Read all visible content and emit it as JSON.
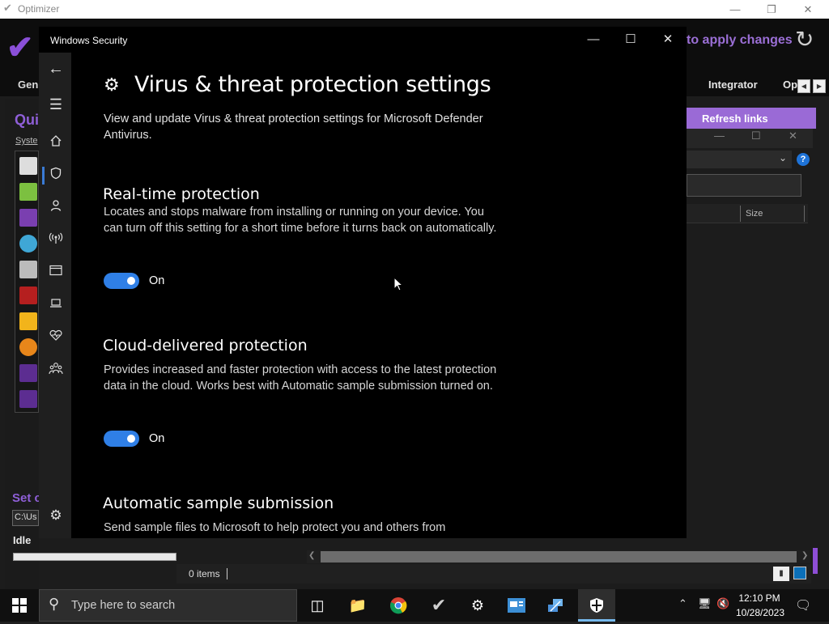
{
  "optimizer": {
    "window_title": "Optimizer",
    "apply_text": "to apply changes",
    "tab_gen": "Gen",
    "tab_integrator": "Integrator",
    "tab_op": "Op",
    "section_qui": "Qui",
    "section_syste": "Syste",
    "section_set": "Set c",
    "path_value": "C:\\Us",
    "status_idle": "Idle",
    "refresh_links": "Refresh links",
    "column_size": "Size",
    "items_count": "0 items",
    "accent_color": "#8e4ed6"
  },
  "security": {
    "window_title": "Windows Security",
    "heading": "Virus & threat protection settings",
    "description": "View and update Virus & threat protection settings for Microsoft Defender Antivirus.",
    "sections": [
      {
        "title": "Real-time protection",
        "description": "Locates and stops malware from installing or running on your device. You can turn off this setting for a short time before it turns back on automatically.",
        "toggle_state": "On"
      },
      {
        "title": "Cloud-delivered protection",
        "description": "Provides increased and faster protection with access to the latest protection data in the cloud. Works best with Automatic sample submission turned on.",
        "toggle_state": "On"
      },
      {
        "title": "Automatic sample submission",
        "description": "Send sample files to Microsoft to help protect you and others from"
      }
    ],
    "toggle_color": "#2f7fe6",
    "nav_icons": [
      "back-icon",
      "menu-icon",
      "home-icon",
      "shield-icon",
      "person-icon",
      "wireless-icon",
      "app-browser-icon",
      "laptop-icon",
      "health-heart-icon",
      "family-icon",
      "settings-gear-icon"
    ]
  },
  "taskbar": {
    "search_placeholder": "Type here to search",
    "time": "12:10 PM",
    "date": "10/28/2023"
  }
}
